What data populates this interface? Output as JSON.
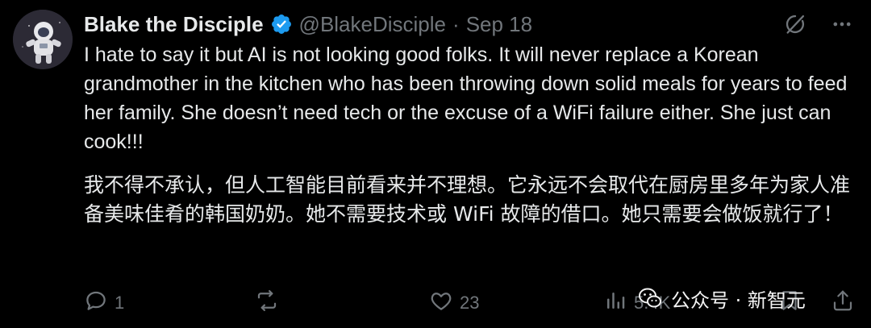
{
  "author": {
    "display_name": "Blake the Disciple",
    "handle": "@BlakeDisciple",
    "separator": "·",
    "date": "Sep 18",
    "verified": true,
    "avatar_icon": "astronaut-avatar"
  },
  "top_actions": {
    "grok_icon": "grok-icon",
    "more_icon": "more-icon"
  },
  "tweet": {
    "text_en": "I hate to say it but AI is not looking good folks. It will never replace a Korean grandmother in the kitchen who has been throwing down solid meals for years to feed her family. She doesn’t need tech or the excuse of a WiFi failure either. She just can cook!!!",
    "text_cn": "我不得不承认，但人工智能目前看来并不理想。它永远不会取代在厨房里多年为家人准备美味佳肴的韩国奶奶。她不需要技术或 WiFi 故障的借口。她只需要会做饭就行了！"
  },
  "actions": {
    "replies": "1",
    "reposts": "",
    "likes": "23",
    "views": "5.4K"
  },
  "watermark": {
    "text": "公众号 · 新智元"
  },
  "colors": {
    "background": "#000000",
    "text": "#e7e9ea",
    "muted": "#71767b",
    "verified_blue": "#1d9bf0"
  }
}
